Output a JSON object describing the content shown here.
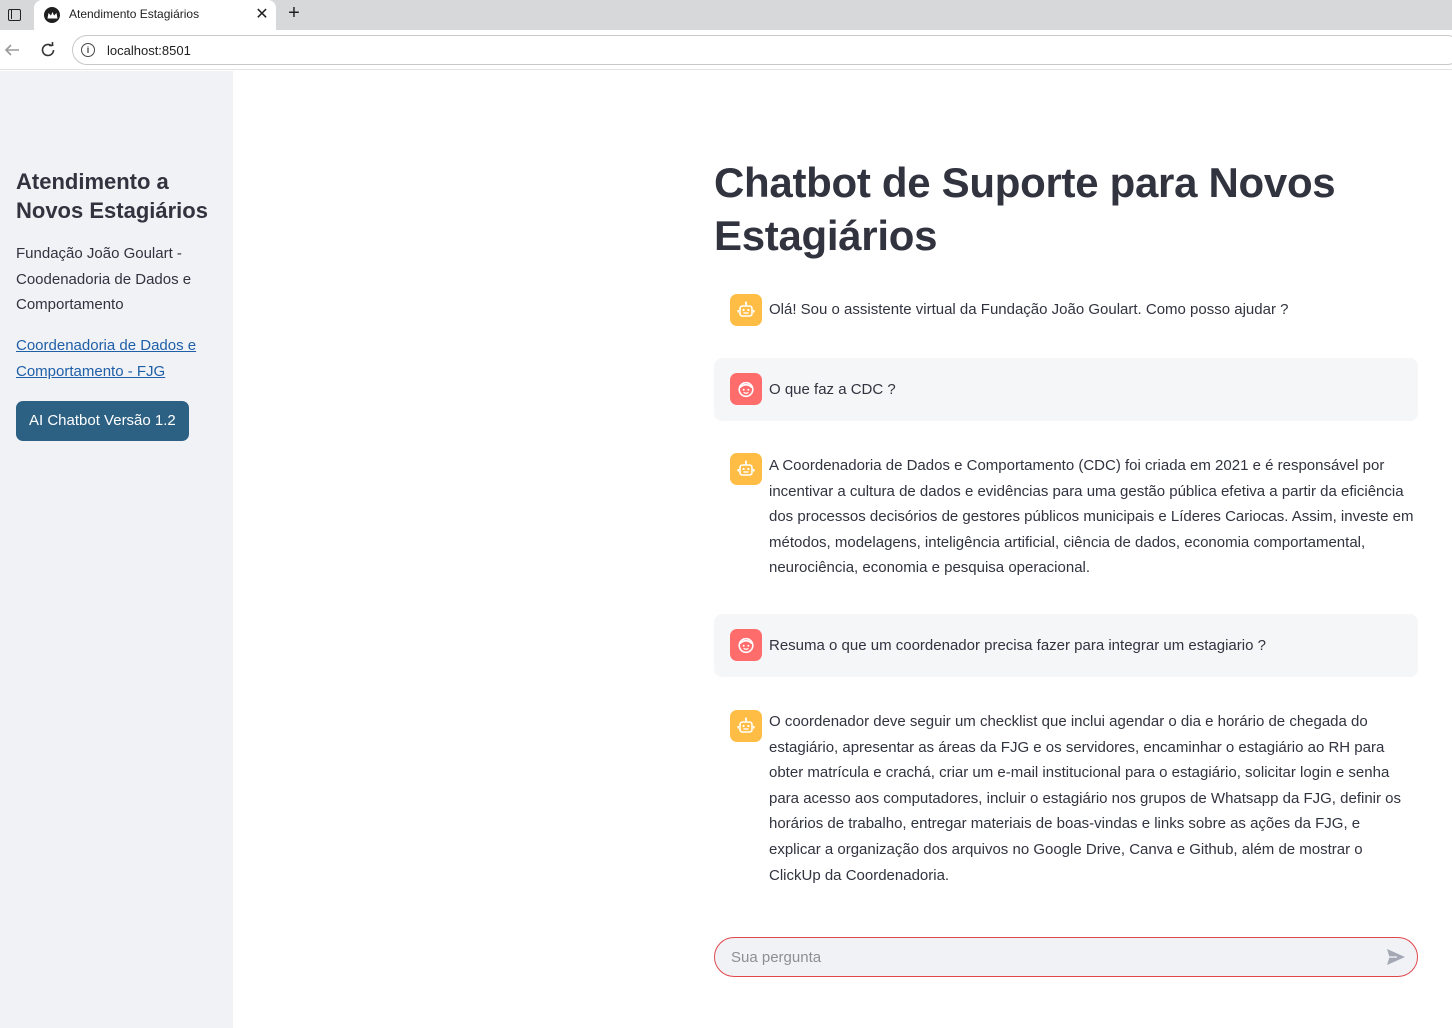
{
  "browser": {
    "tab_title": "Atendimento Estagiários",
    "url": "localhost:8501"
  },
  "sidebar": {
    "title": "Atendimento a Novos Estagiários",
    "description": "Fundação João Goulart - Coodenadoria de Dados e Comportamento",
    "link_text": "Coordenadoria de Dados e Comportamento - FJG",
    "button_label": "AI Chatbot Versão 1.2"
  },
  "main": {
    "title": "Chatbot de Suporte para Novos Estagiários",
    "messages": [
      {
        "role": "assistant",
        "text": "Olá! Sou o assistente virtual da Fundação João Goulart. Como posso ajudar ?"
      },
      {
        "role": "user",
        "text": "O que faz a CDC ?"
      },
      {
        "role": "assistant",
        "text": "A Coordenadoria de Dados e Comportamento (CDC) foi criada em 2021 e é responsável por incentivar a cultura de dados e evidências para uma gestão pública efetiva a partir da eficiência dos processos decisórios de gestores públicos municipais e Líderes Cariocas. Assim, investe em métodos, modelagens, inteligência artificial, ciência de dados, economia comportamental, neurociência, economia e pesquisa operacional."
      },
      {
        "role": "user",
        "text": "Resuma o que um coordenador precisa fazer para integrar um estagiario ?"
      },
      {
        "role": "assistant",
        "text": "O coordenador deve seguir um checklist que inclui agendar o dia e horário de chegada do estagiário, apresentar as áreas da FJG e os servidores, encaminhar o estagiário ao RH para obter matrícula e crachá, criar um e-mail institucional para o estagiário, solicitar login e senha para acesso aos computadores, incluir o estagiário nos grupos de Whatsapp da FJG, definir os horários de trabalho, entregar materiais de boas-vindas e links sobre as ações da FJG, e explicar a organização dos arquivos no Google Drive, Canva e Github, além de mostrar o ClickUp da Coordenadoria."
      }
    ],
    "input": {
      "placeholder": "Sua pergunta",
      "value": ""
    }
  },
  "colors": {
    "sidebar_bg": "#f0f2f6",
    "button_bg": "#2d6184",
    "bot_avatar": "#ffbd45",
    "user_avatar": "#ff6c6c",
    "input_border": "#e0474c"
  },
  "icons": {
    "bot_avatar": "robot-icon",
    "user_avatar": "user-face-icon",
    "send": "send-icon"
  }
}
